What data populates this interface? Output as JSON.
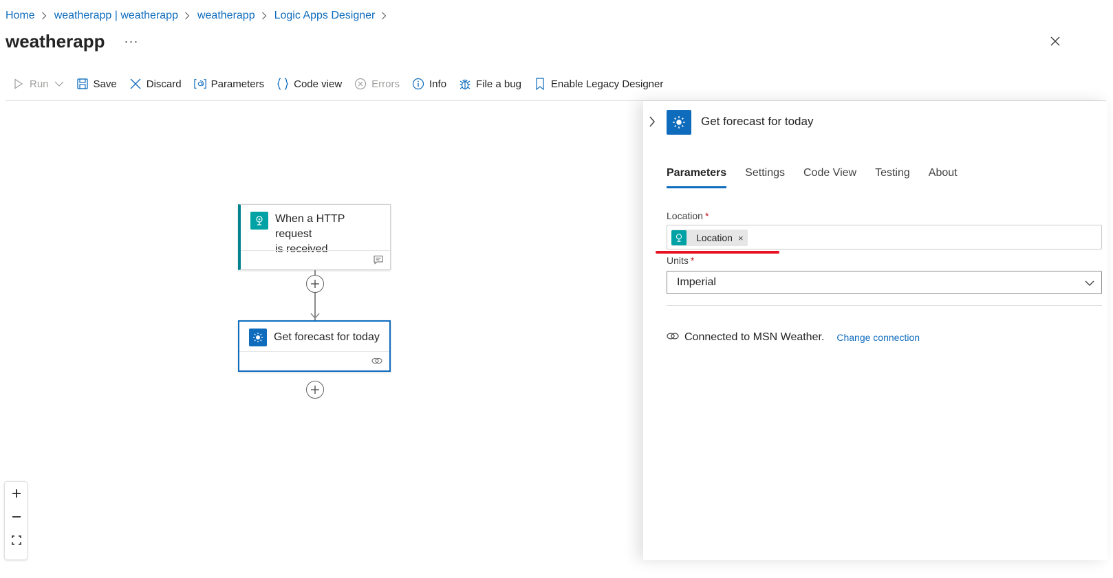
{
  "breadcrumb": {
    "items": [
      "Home",
      "weatherapp | weatherapp",
      "weatherapp",
      "Logic Apps Designer"
    ]
  },
  "header": {
    "title": "weatherapp",
    "more": "···"
  },
  "toolbar": {
    "run": "Run",
    "save": "Save",
    "discard": "Discard",
    "parameters": "Parameters",
    "code_view": "Code view",
    "errors": "Errors",
    "info": "Info",
    "file_bug": "File a bug",
    "legacy": "Enable Legacy Designer"
  },
  "canvas": {
    "trigger": {
      "line1": "When a HTTP request",
      "line2": "is received"
    },
    "action": {
      "title": "Get forecast for today"
    }
  },
  "panel": {
    "title": "Get forecast for today",
    "tabs": [
      "Parameters",
      "Settings",
      "Code View",
      "Testing",
      "About"
    ],
    "active_tab": "Parameters",
    "location": {
      "label": "Location",
      "required": "*",
      "token": "Location",
      "token_remove": "×"
    },
    "units": {
      "label": "Units",
      "required": "*",
      "value": "Imperial"
    },
    "connection": {
      "text": "Connected to MSN Weather.",
      "link": "Change connection"
    }
  },
  "colors": {
    "accent": "#0f6cbd",
    "teal": "#00a2a5",
    "annotation_red": "#e81123",
    "required_red": "#c50f1f"
  },
  "icons": [
    "chevron-right-icon",
    "close-icon",
    "play-icon",
    "chevron-down-icon",
    "save-icon",
    "discard-icon",
    "parameters-icon",
    "code-braces-icon",
    "error-circle-icon",
    "info-icon",
    "bug-icon",
    "bookmark-icon",
    "request-icon",
    "weather-sun-icon",
    "comment-icon",
    "link-icon",
    "plus-circle-icon",
    "zoom-in-icon",
    "zoom-out-icon",
    "fit-view-icon",
    "minimap-icon"
  ]
}
